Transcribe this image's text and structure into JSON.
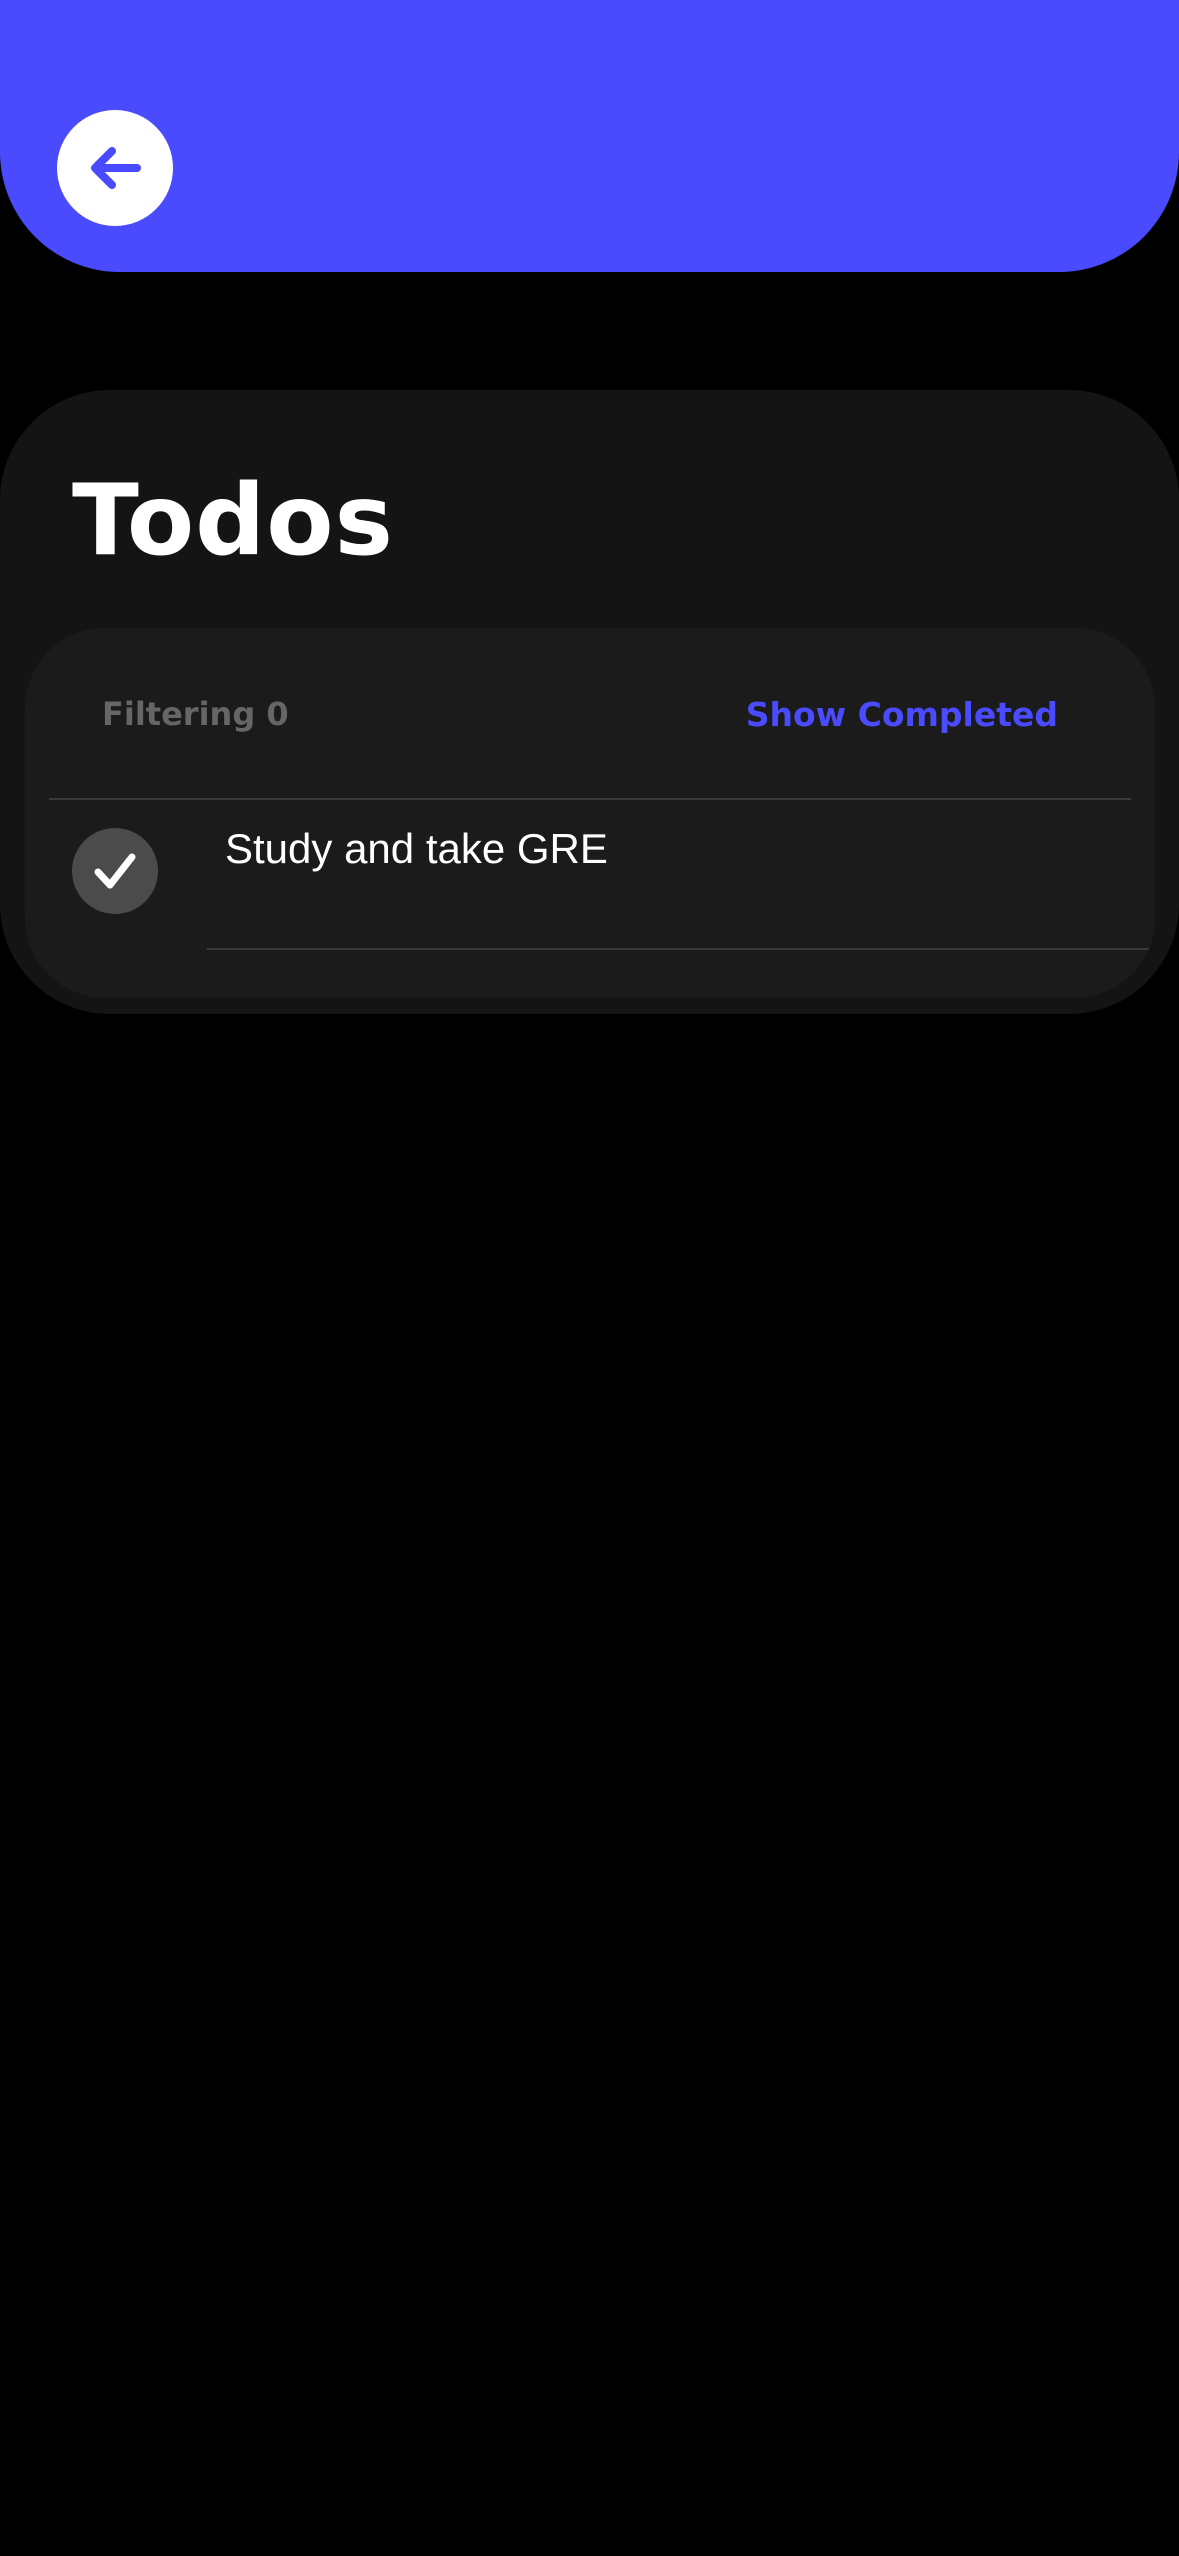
{
  "header": {
    "back_icon": "arrow-left-icon",
    "background_color": "#4A4BFF"
  },
  "panel": {
    "title": "Todos"
  },
  "filters": {
    "filter_label": "Filtering 0",
    "show_completed_label": "Show Completed",
    "accent_color": "#4A4BFF"
  },
  "todos": [
    {
      "title": "Study and take GRE",
      "completed": true,
      "check_icon": "checkmark-icon"
    }
  ]
}
